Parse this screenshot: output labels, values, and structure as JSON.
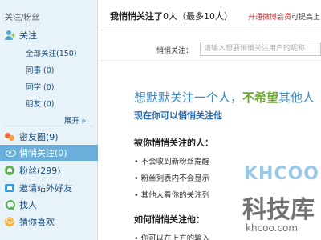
{
  "sidebar": {
    "header": "关注/粉丝",
    "follow": {
      "label": "关注",
      "icon": "follow-icon"
    },
    "groups": [
      {
        "label": "全部关注(150)"
      },
      {
        "label": "同事 (0)"
      },
      {
        "label": "同学 (0)"
      },
      {
        "label": "朋友 (0)"
      }
    ],
    "expand_label": "展开",
    "expand_arrow": "»",
    "items": [
      {
        "label": "密友圈(9)",
        "icon": "close-friends-icon"
      },
      {
        "label": "悄悄关注(0)",
        "icon": "eye-icon",
        "active": true
      },
      {
        "label": "粉丝(299)",
        "icon": "fans-icon"
      },
      {
        "label": "邀请站外好友",
        "icon": "invite-icon"
      },
      {
        "label": "找人",
        "icon": "find-people-icon"
      },
      {
        "label": "猜你喜欢",
        "icon": "guess-like-icon"
      }
    ]
  },
  "header": {
    "title_prefix": "我悄悄关注了",
    "count": "0人",
    "limit": "（最多10人）",
    "link_label": "开通微博会员",
    "link_rest": "可提高上"
  },
  "search": {
    "label": "悄悄关注：",
    "placeholder": "请输入想要悄悄关注用户的昵称"
  },
  "intro": {
    "hero_pre": "想默默关注一个人，",
    "hero_em": "不希望",
    "hero_post": "其他人",
    "subhero": "现在你可以悄悄关注他"
  },
  "section1": {
    "title": "被你悄悄关注的人：",
    "bullets": [
      "• 不会收到新粉丝提醒",
      "• 粉丝列表内不会显示",
      "• 其他人看你的关注列"
    ]
  },
  "section2": {
    "title": "如何悄悄关注他：",
    "bullets": [
      "• 你可以在上方的输入"
    ]
  },
  "watermark": {
    "logo_text": "KHCOO",
    "brand": "科技库",
    "url": "khcoo.com"
  },
  "colors": {
    "sidebar_bg": "#e8f3f9",
    "active_bg": "#6aaedb",
    "link_blue": "#1a4d7d",
    "hero_blue": "#3a8ac6",
    "hero_green": "#6aaa2a",
    "alert_red": "#c03030"
  }
}
